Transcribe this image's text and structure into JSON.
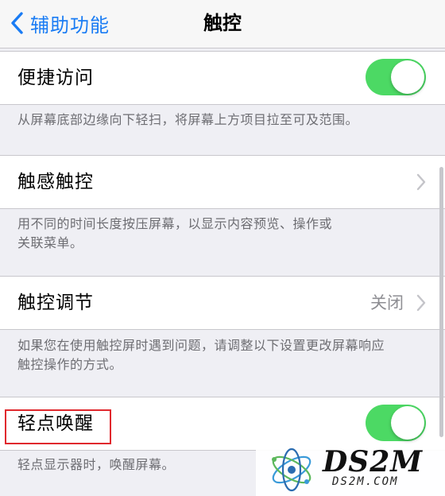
{
  "navbar": {
    "back_label": "辅助功能",
    "title": "触控"
  },
  "sections": [
    {
      "label": "便捷访问",
      "control": "toggle",
      "toggle_on": true,
      "footer": "从屏幕底部边缘向下轻扫，将屏幕上方项目拉至可及范围。"
    },
    {
      "label": "触感触控",
      "control": "disclosure",
      "footer_lines": [
        "用不同的时间长度按压屏幕，以显示内容预览、操作或",
        "关联菜单。"
      ]
    },
    {
      "label": "触控调节",
      "control": "disclosure",
      "value": "关闭",
      "footer_lines": [
        "如果您在使用触控屏时遇到问题，请调整以下设置更改屏幕响应",
        "触控操作的方式。"
      ]
    },
    {
      "label": "轻点唤醒",
      "control": "toggle",
      "toggle_on": true,
      "footer": "轻点显示器时，唤醒屏幕。"
    }
  ],
  "watermark": {
    "text": "DS2M",
    "subtext": "DS2M.COM"
  },
  "colors": {
    "accent": "#1a7cf4",
    "toggle_on": "#4cd964",
    "highlight": "#e0282d",
    "background": "#efeff4"
  },
  "icons": [
    "chevron-left-icon",
    "chevron-right-icon"
  ]
}
